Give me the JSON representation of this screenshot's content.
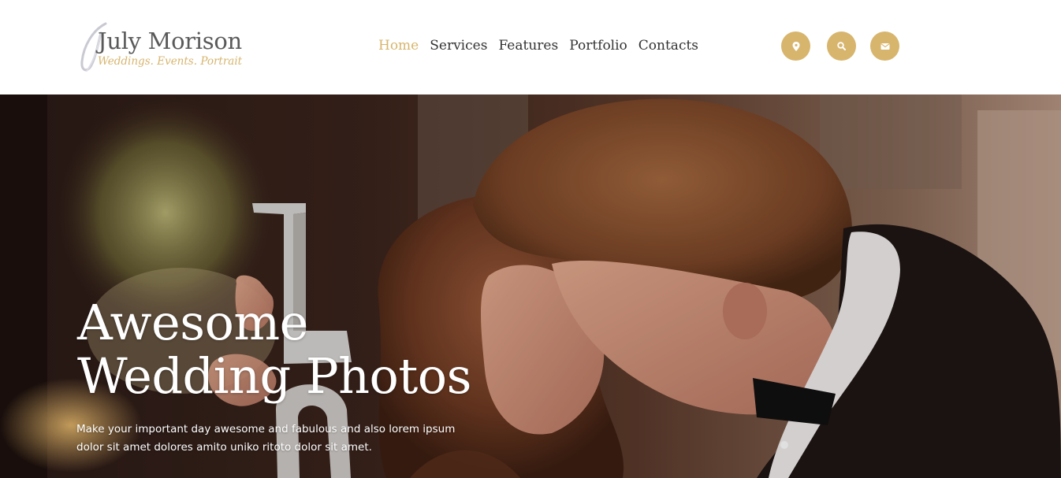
{
  "brand": {
    "name": "July Morison",
    "tagline": "Weddings. Events. Portrait"
  },
  "nav": {
    "items": [
      {
        "label": "Home",
        "active": true
      },
      {
        "label": "Services",
        "active": false
      },
      {
        "label": "Features",
        "active": false
      },
      {
        "label": "Portfolio",
        "active": false
      },
      {
        "label": "Contacts",
        "active": false
      }
    ]
  },
  "header_actions": [
    {
      "icon": "map-pin-icon"
    },
    {
      "icon": "search-icon"
    },
    {
      "icon": "envelope-icon"
    }
  ],
  "hero": {
    "title_line1": "Awesome",
    "title_line2": "Wedding Photos",
    "desc_line1": "Make your important day awesome and fabulous and also lorem ipsum",
    "desc_line2": "dolor sit amet dolores amito uniko ritoto dolor sit amet.",
    "image": "kissing-couple-photo"
  },
  "colors": {
    "accent": "#d7b56d",
    "nav_text": "#333333",
    "logo_text": "#5a5a5a"
  }
}
